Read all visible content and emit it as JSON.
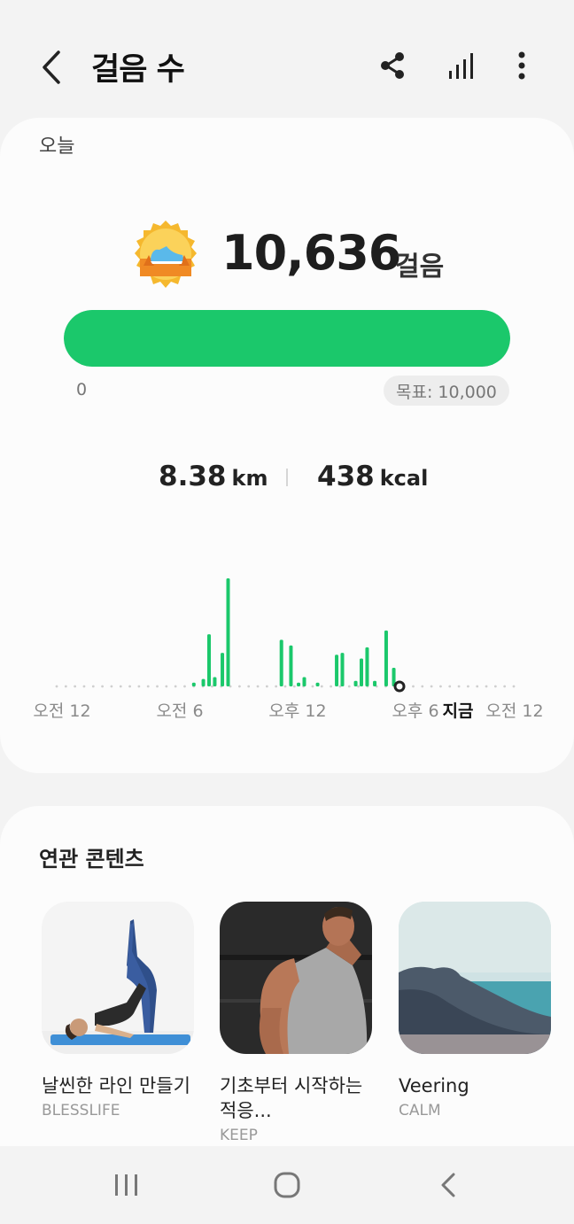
{
  "header": {
    "title": "걸음 수",
    "icons": [
      "back-arrow-icon",
      "share-icon",
      "bar-chart-icon",
      "more-vertical-icon"
    ]
  },
  "today": {
    "label": "오늘",
    "steps": "10,636",
    "unit": "걸음",
    "progress_fraction": 1.0,
    "progress_min": "0",
    "goal": "목표: 10,000",
    "distance": "8.38",
    "distance_unit": "km",
    "calories": "438",
    "calories_unit": "kcal"
  },
  "chart_data": {
    "type": "bar",
    "title": "",
    "xlabel": "",
    "ylabel": "",
    "tick_labels": [
      "오전 12",
      "오전 6",
      "오후 12",
      "오후 6",
      "지금",
      "오전 12"
    ],
    "bar_color": "#1bc86b",
    "hours": [
      7.2,
      7.7,
      8.0,
      8.3,
      8.7,
      9.0,
      11.8,
      12.3,
      12.7,
      13.0,
      13.7,
      14.7,
      15.0,
      15.7,
      16.0,
      16.3,
      16.7,
      17.3,
      17.7
    ],
    "values": [
      2,
      4,
      28,
      5,
      18,
      58,
      25,
      22,
      2,
      5,
      2,
      17,
      18,
      3,
      15,
      21,
      3,
      30,
      10
    ],
    "now_hour": 18.0
  },
  "related": {
    "title": "연관 콘텐츠",
    "items": [
      {
        "title": "날씬한 라인 만들기",
        "source": "BLESSLIFE"
      },
      {
        "title": "기초부터 시작하는 적응...",
        "source": "KEEP"
      },
      {
        "title": "Veering",
        "source": "CALM"
      }
    ]
  },
  "navbar": {
    "icons": [
      "recent-apps-icon",
      "home-icon",
      "back-icon"
    ]
  }
}
